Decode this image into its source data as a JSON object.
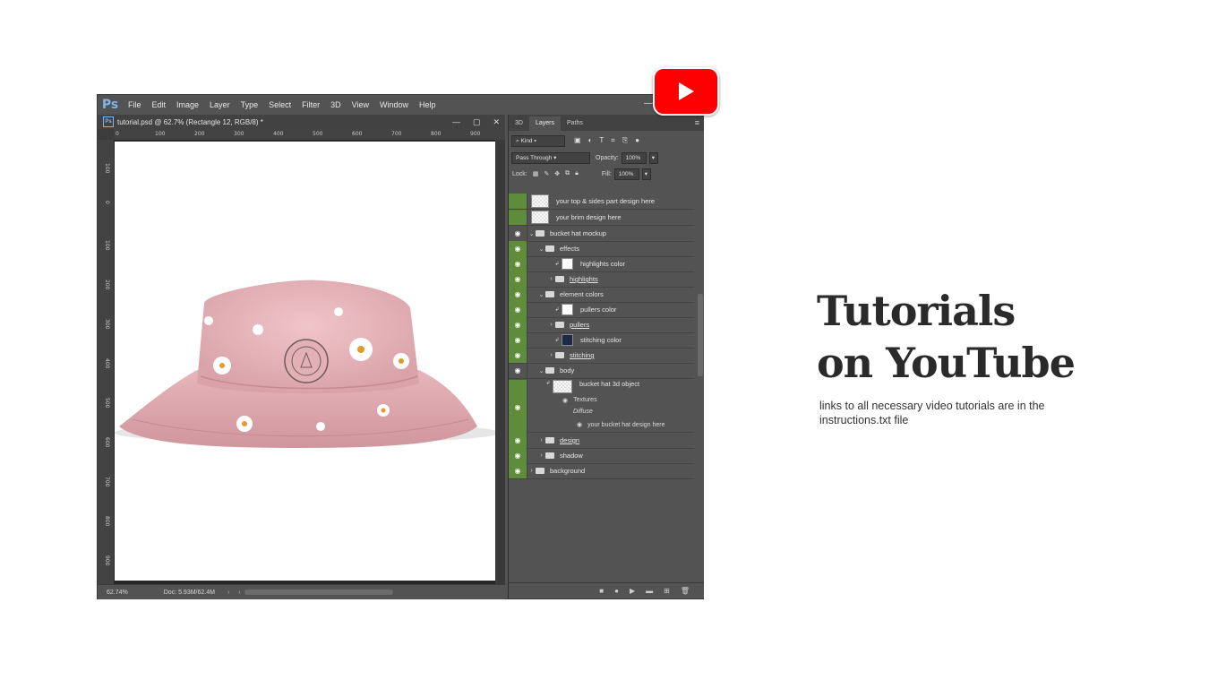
{
  "menubar": {
    "logo": "Ps",
    "items": [
      "File",
      "Edit",
      "Image",
      "Layer",
      "Type",
      "Select",
      "Filter",
      "3D",
      "View",
      "Window",
      "Help"
    ]
  },
  "document": {
    "icon": "Ps",
    "title": "tutorial.psd @ 62.7% (Rectangle 12, RGB/8) *",
    "ruler_top": [
      "0",
      "100",
      "200",
      "300",
      "400",
      "500",
      "600",
      "700",
      "800",
      "900"
    ],
    "ruler_left": [
      "100",
      "0",
      "100",
      "200",
      "300",
      "400",
      "500",
      "600",
      "700",
      "800",
      "900"
    ]
  },
  "status": {
    "zoom": "62.74%",
    "doc": "Doc: 5.93M/62.4M"
  },
  "panel": {
    "tabs": [
      "3D",
      "Layers",
      "Paths"
    ],
    "kind": "Kind",
    "blend": "Pass Through",
    "opacity_label": "Opacity:",
    "opacity_value": "100%",
    "lock_label": "Lock:",
    "fill_label": "Fill:",
    "fill_value": "100%"
  },
  "layers": [
    {
      "name": "your top & sides part design here"
    },
    {
      "name": "your brim design here"
    },
    {
      "name": "bucket hat mockup"
    },
    {
      "name": "effects"
    },
    {
      "name": "highlights color"
    },
    {
      "name": "highlights"
    },
    {
      "name": "element colors"
    },
    {
      "name": "pullers color"
    },
    {
      "name": "pullers"
    },
    {
      "name": "stitching color"
    },
    {
      "name": "stitching"
    },
    {
      "name": "body"
    },
    {
      "name": "bucket hat 3d object"
    },
    {
      "name": "Textures"
    },
    {
      "name": "Diffuse"
    },
    {
      "name": "your bucket hat design here"
    },
    {
      "name": "design"
    },
    {
      "name": "shadow"
    },
    {
      "name": "background"
    }
  ],
  "promo": {
    "title_line1": "Tutorials",
    "title_line2": "on YouTube",
    "subtitle": "links to all necessary video tutorials are in the instructions.txt file"
  },
  "colors": {
    "hat_pink": "#e8b7bc",
    "youtube_red": "#ff0000",
    "eye_green": "#5e8c3a"
  }
}
